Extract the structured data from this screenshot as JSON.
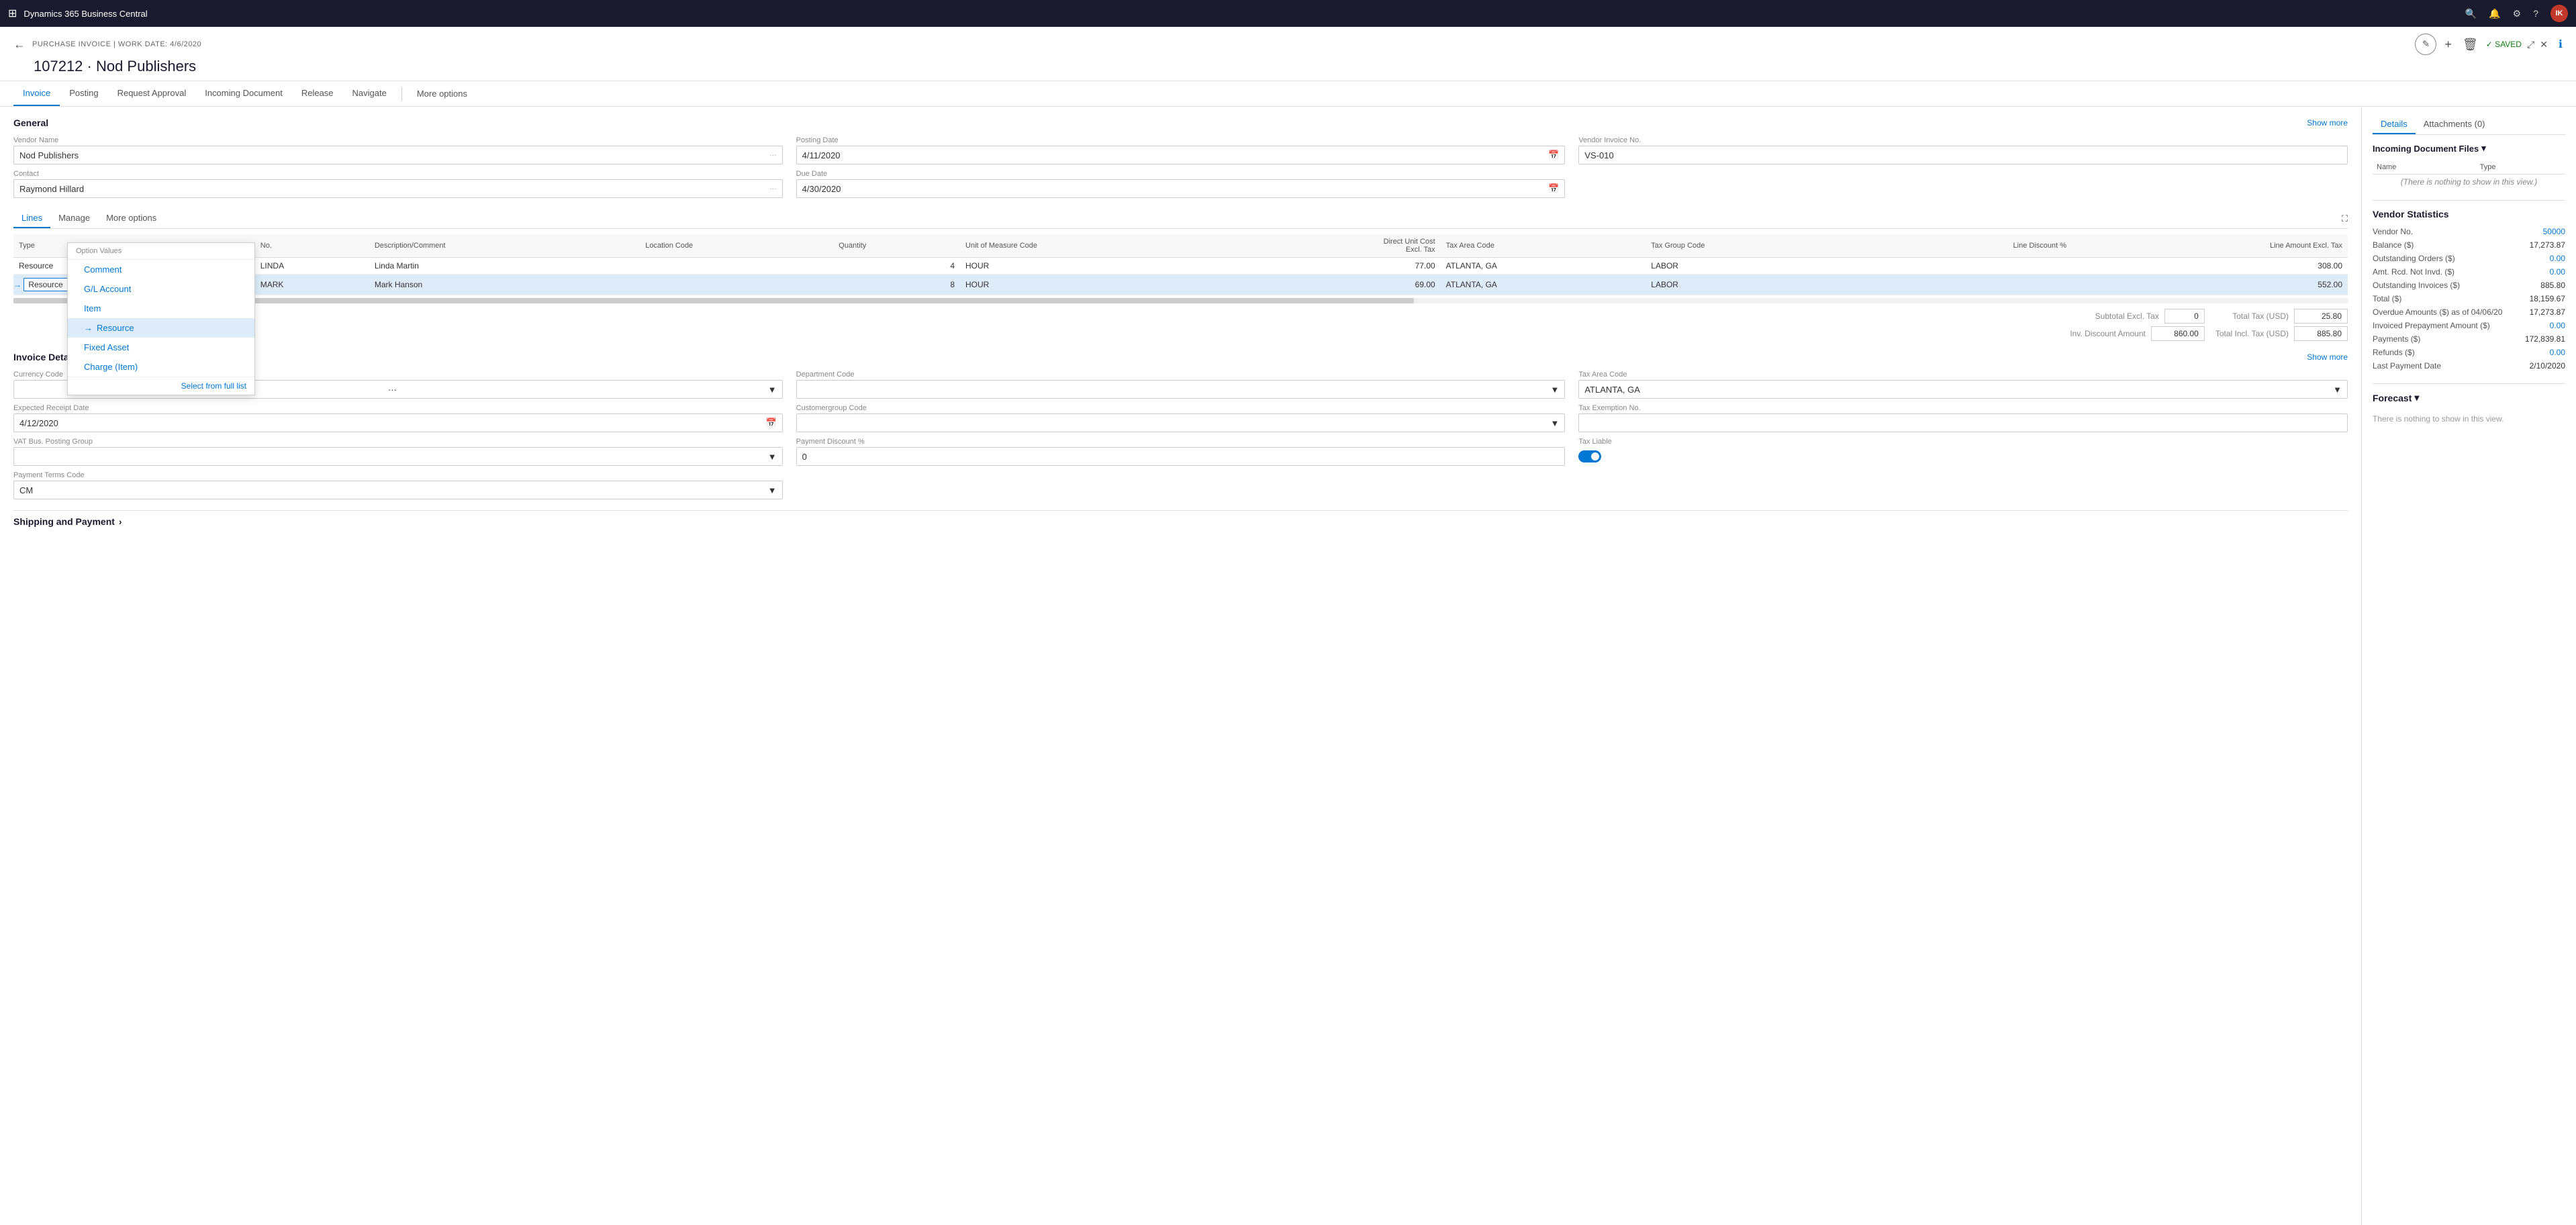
{
  "app": {
    "title": "Dynamics 365 Business Central",
    "nav_icon": "⊞"
  },
  "header": {
    "back_label": "←",
    "subtitle": "PURCHASE INVOICE | WORK DATE: 4/6/2020",
    "title": "107212 · Nod Publishers",
    "edit_icon": "✎",
    "add_icon": "+",
    "delete_icon": "🗑",
    "saved_label": "✓ SAVED",
    "expand_icon": "⤢",
    "collapse_icon": "✕"
  },
  "tabs": [
    {
      "label": "Invoice",
      "active": true
    },
    {
      "label": "Posting",
      "active": false
    },
    {
      "label": "Request Approval",
      "active": false
    },
    {
      "label": "Incoming Document",
      "active": false
    },
    {
      "label": "Release",
      "active": false
    },
    {
      "label": "Navigate",
      "active": false
    },
    {
      "label": "More options",
      "active": false
    }
  ],
  "general": {
    "title": "General",
    "show_more": "Show more",
    "fields": {
      "vendor_name_label": "Vendor Name",
      "vendor_name_value": "Nod Publishers",
      "contact_label": "Contact",
      "contact_value": "Raymond Hillard",
      "posting_date_label": "Posting Date",
      "posting_date_value": "4/11/2020",
      "due_date_label": "Due Date",
      "due_date_value": "4/30/2020",
      "vendor_invoice_label": "Vendor Invoice No.",
      "vendor_invoice_value": "VS-010"
    }
  },
  "lines": {
    "tabs": [
      "Lines",
      "Manage",
      "More options"
    ],
    "columns": [
      "Type",
      "No.",
      "Description/Comment",
      "Location Code",
      "Quantity",
      "Unit of Measure Code",
      "Direct Unit Cost Excl. Tax",
      "Tax Area Code",
      "Tax Group Code",
      "Line Discount %",
      "Line Amount Excl. Tax"
    ],
    "rows": [
      {
        "type": "Resource",
        "no": "LINDA",
        "desc": "Linda Martin",
        "location": "",
        "qty": "4",
        "uom": "HOUR",
        "unit_cost": "77.00",
        "tax_area": "ATLANTA, GA",
        "tax_group": "LABOR",
        "line_disc": "",
        "line_amount": "308.00",
        "selected": false
      },
      {
        "type": "Resource",
        "no": "MARK",
        "desc": "Mark Hanson",
        "location": "",
        "qty": "8",
        "uom": "HOUR",
        "unit_cost": "69.00",
        "tax_area": "ATLANTA, GA",
        "tax_group": "LABOR",
        "line_disc": "",
        "line_amount": "552.00",
        "selected": true
      }
    ],
    "dropdown": {
      "header": "Option Values",
      "items": [
        {
          "label": "Comment",
          "selected": false
        },
        {
          "label": "G/L Account",
          "selected": false
        },
        {
          "label": "Item",
          "selected": false
        },
        {
          "label": "Resource",
          "selected": true
        },
        {
          "label": "Fixed Asset",
          "selected": false
        },
        {
          "label": "Charge (Item)",
          "selected": false
        }
      ],
      "footer": "Select from full list"
    },
    "subtotal_label": "Subtotal Excl. Tax (USD)",
    "subtotal_value": "",
    "subtotal_pct": "0",
    "inv_discount_label": "Inv. Discount Amount (USD)",
    "inv_discount_value": "860.00",
    "total_tax_label": "Total Tax (USD)",
    "total_tax_value": "25.80",
    "total_incl_label": "Total Incl. Tax (USD)",
    "total_incl_value": "885.80"
  },
  "invoice_details": {
    "title": "Invoice Details",
    "show_more": "Show more",
    "fields": {
      "currency_code_label": "Currency Code",
      "currency_code_value": "",
      "expected_receipt_label": "Expected Receipt Date",
      "expected_receipt_value": "4/12/2020",
      "vat_bus_label": "VAT Bus. Posting Group",
      "vat_bus_value": "",
      "department_code_label": "Department Code",
      "department_code_value": "",
      "customergroup_label": "Customergroup Code",
      "customergroup_value": "",
      "payment_discount_label": "Payment Discount %",
      "payment_discount_value": "0",
      "tax_area_label": "Tax Area Code",
      "tax_area_value": "ATLANTA, GA",
      "tax_exempt_label": "Tax Exemption No.",
      "tax_exempt_value": "",
      "payment_terms_label": "Payment Terms Code",
      "payment_terms_value": "CM",
      "tax_liable_label": "Tax Liable",
      "tax_liable_value": "on"
    }
  },
  "right_panel": {
    "tabs": [
      {
        "label": "Details",
        "active": true
      },
      {
        "label": "Attachments (0)",
        "active": false
      }
    ],
    "incoming_files": {
      "title": "Incoming Document Files",
      "col_name": "Name",
      "col_type": "Type",
      "empty_message": "(There is nothing to show in this view.)"
    },
    "vendor_stats": {
      "title": "Vendor Statistics",
      "items": [
        {
          "label": "Vendor No.",
          "value": "50000"
        },
        {
          "label": "Balance ($)",
          "value": "17,273.87"
        },
        {
          "label": "Outstanding Orders ($)",
          "value": "0.00"
        },
        {
          "label": "Amt. Rcd. Not Invd. ($)",
          "value": "0.00"
        },
        {
          "label": "Outstanding Invoices ($)",
          "value": "885.80"
        },
        {
          "label": "Total ($)",
          "value": "18,159.67"
        },
        {
          "label": "Overdue Amounts ($) as of 04/06/20",
          "value": "17,273.87"
        },
        {
          "label": "Invoiced Prepayment Amount ($)",
          "value": "0.00"
        },
        {
          "label": "Payments ($)",
          "value": "172,839.81"
        },
        {
          "label": "Refunds ($)",
          "value": "0.00"
        },
        {
          "label": "Last Payment Date",
          "value": "2/10/2020"
        }
      ]
    },
    "forecast": {
      "title": "Forecast",
      "empty_message": "There is nothing to show in this view."
    }
  }
}
